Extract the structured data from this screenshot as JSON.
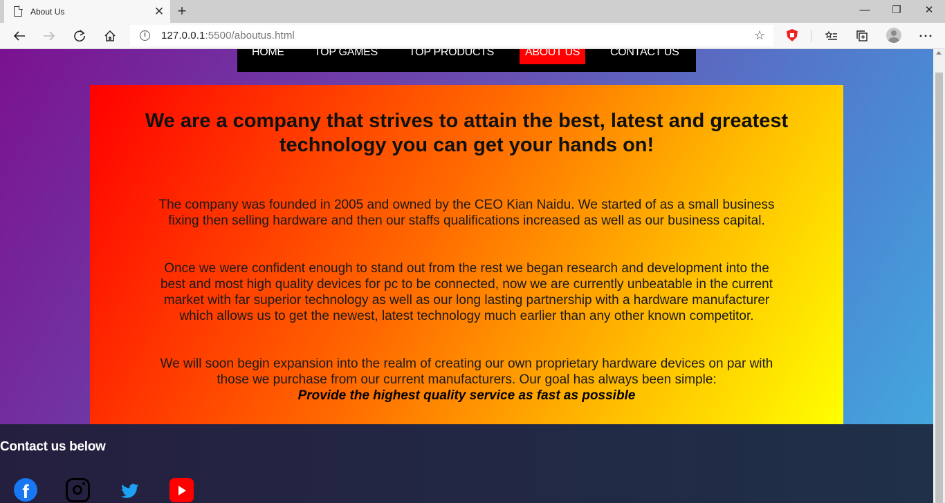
{
  "browser": {
    "tab_title": "About Us",
    "tab_close": "✕",
    "new_tab": "+",
    "url_host": "127.0.0.1",
    "url_rest": ":5500/aboutus.html",
    "window_controls": {
      "minimize": "—",
      "restore": "❐",
      "close": "✕"
    }
  },
  "nav": {
    "items": [
      {
        "label": "HOME"
      },
      {
        "label": "TOP GAMES"
      },
      {
        "label": "TOP PRODUCTS"
      },
      {
        "label": "ABOUT US",
        "active": true
      },
      {
        "label": "CONTACT US"
      }
    ]
  },
  "about": {
    "heading": "We are a company that strives to attain the best, latest and greatest technology you can get your hands on!",
    "para1": "The company was founded in 2005 and owned by the CEO Kian Naidu. We started of as a small business fixing then selling hardware and then our staffs qualifications increased as well as our business capital.",
    "para2": "Once we were confident enough to stand out from the rest we began research and development into the best and most high quality devices for pc to be connected, now we are currently unbeatable in the current market with far superior technology as well as our long lasting partnership with a hardware manufacturer which allows us to get the newest, latest technology much earlier than any other known competitor.",
    "para3": "We will soon begin expansion into the realm of creating our own proprietary hardware devices on par with those we purchase from our current manufacturers. Our goal has always been simple:",
    "motto": "Provide the highest quality service as fast as possible"
  },
  "footer": {
    "title": "Contact us below",
    "social": [
      "facebook-icon",
      "instagram-icon",
      "twitter-icon",
      "youtube-icon"
    ]
  },
  "colors": {
    "nav_bg": "#000000",
    "nav_active": "#ff0000",
    "box_gradient_start": "#ff0000",
    "box_gradient_end": "#ffff00"
  }
}
